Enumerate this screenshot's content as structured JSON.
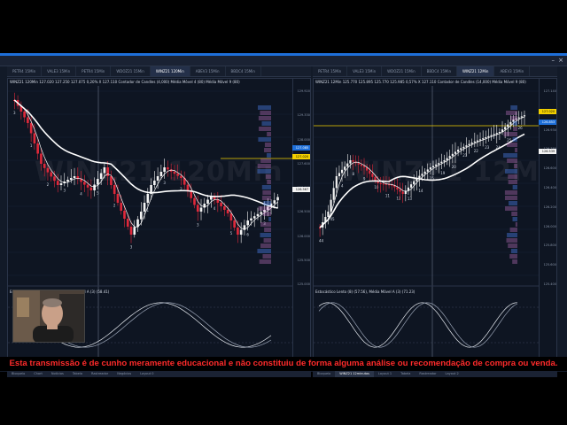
{
  "window": {
    "close_label": "×",
    "minimize_label": "–"
  },
  "left_tabs": [
    "PETR4 15Min",
    "VALE3 15Min",
    "PETR4 15Min",
    "WDOZ21 15Min",
    "WINZ21 120Min",
    "ABEV3 15Min",
    "BBDC4 15Min"
  ],
  "left_active_tab": 4,
  "right_tabs": [
    "PETR4 15Min",
    "VALE3 15Min",
    "WDOZ21 15Min",
    "BBDC4 15Min",
    "WINZ21 12Min",
    "ABEV3 15Min"
  ],
  "right_active_tab": 4,
  "left_chart": {
    "header": "WINZ21 120Min  127.020  127.250  127.075  0,20%  X 127.110  Contador de Candles (4,000)  Média Móvel 4 (80)  Média Móvel 9 (80)",
    "watermark": "WINZ21 120Min",
    "oscillator_title": "Estocástico Lento (8) (51.93), Média Móvel A (3) (58.41)",
    "price_labels": [
      "129.920",
      "129.330",
      "128.000",
      "127.600",
      "127.000",
      "126.500",
      "126.000",
      "125.500",
      "125.000"
    ],
    "price_tags": [
      {
        "label": "127.085",
        "color": "#1e6fd9"
      },
      {
        "label": "127.020",
        "color": "#f2d000"
      },
      {
        "label": "126.567",
        "color": "#f3f3f3"
      }
    ],
    "time_labels": [
      "14:00",
      "17:00",
      "10:00",
      "12:00",
      "14:00",
      "16:00",
      "11:00",
      "13:00",
      "15:00",
      "09:00"
    ],
    "time_highlight": "29/11/2021 12:00",
    "clock": "22:22",
    "candle_counts": [
      "3",
      "1",
      "2",
      "3",
      "4",
      "5",
      "2",
      "3",
      "1",
      "3",
      "2",
      "3",
      "4",
      "5",
      "6",
      "3"
    ]
  },
  "right_chart": {
    "header": "WINZ21 12Min  125.770  125.895  125.770  125.985  0,57%  X 127.110  Contador de Candles (14,000)  Média Móvel 9 (80)",
    "watermark": "WINZ21 12Min",
    "oscillator_title": "Estocástico Lento (8) (57.56), Média Móvel A (3) (71.23)",
    "price_labels": [
      "127.140",
      "127.060",
      "126.930",
      "126.760",
      "126.600",
      "126.400",
      "126.200",
      "126.000",
      "125.800",
      "125.600",
      "125.400"
    ],
    "price_tags": [
      {
        "label": "127.020",
        "color": "#f2d000"
      },
      {
        "label": "126.853",
        "color": "#1e6fd9"
      },
      {
        "label": "126.539",
        "color": "#f3f3f3"
      }
    ],
    "time_labels": [
      "17:56",
      "09:13",
      "09:48",
      "10:24",
      "11:00",
      "11:36",
      "12:12",
      "12:48",
      "13:24",
      "14:00"
    ],
    "clock": "23:22",
    "candle_counts": [
      "44",
      "45",
      "4",
      "8",
      "9",
      "10",
      "11",
      "12",
      "13",
      "14",
      "15",
      "19",
      "20",
      "21",
      "22",
      "23",
      "24",
      "25",
      "26",
      "27",
      "28"
    ]
  },
  "bottom_tabs_left": [
    "Bloqueio",
    "Chart",
    "Notícias",
    "Tabela",
    "Rastreador",
    "Negócios",
    "Layout 0"
  ],
  "bottom_tabs_right": [
    "Bloqueio",
    "WINZ21 12minutos",
    "Layout 1",
    "Tabela",
    "Rastreador",
    "Layout 2"
  ],
  "disclaimer": "Esta transmissão é de cunho meramente educacional e não constituiu de forma alguma análise ou recomendação de compra ou venda.",
  "colors": {
    "up": "#f3f3f3",
    "down": "#e0283a",
    "ma_fast": "#ffffff",
    "ma_slow": "#ffffff",
    "level_line": "#f2d000"
  }
}
